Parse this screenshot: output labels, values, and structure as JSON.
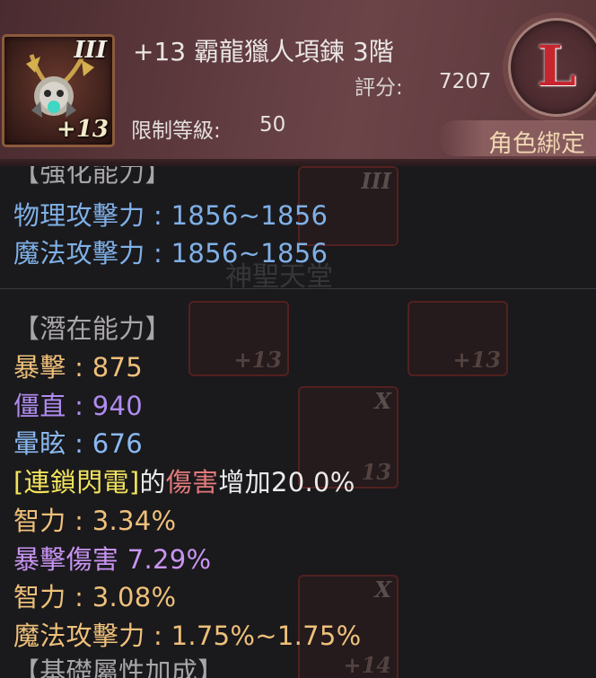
{
  "item": {
    "grade_numeral": "III",
    "enhance_badge": "+13",
    "title": "+13 霸龍獵人項鍊 3階",
    "score_label": "評分:",
    "score_value": "7207",
    "level_label": "限制等級:",
    "level_value": "50",
    "rank_letter": "L",
    "bind_status": "角色綁定"
  },
  "enhance_section": {
    "header": "【強化能力】",
    "stats": [
      {
        "label": "物理攻擊力 : 1856~1856"
      },
      {
        "label": "魔法攻擊力 : 1856~1856"
      }
    ]
  },
  "watermark": "神聖天堂",
  "potential_section": {
    "header": "【潛在能力】",
    "stats": [
      {
        "text": "暴擊 : 875"
      },
      {
        "text": "僵直 : 940"
      },
      {
        "text": "暈眩 : 676"
      },
      {
        "skill": "[連鎖閃電]",
        "of": "的",
        "damage": "傷害",
        "rest": "增加20.0%"
      },
      {
        "text": "智力 : 3.34%"
      },
      {
        "text": "暴擊傷害 7.29%"
      },
      {
        "text": "智力 : 3.08%"
      },
      {
        "text": "魔法攻擊力 : 1.75%~1.75%"
      }
    ]
  },
  "base_section": {
    "header": "【基礎屬性加成】"
  },
  "ghost_slots": [
    {
      "grade": "III",
      "badge": ""
    },
    {
      "grade": "",
      "badge": "+13"
    },
    {
      "grade": "",
      "badge": "+13"
    },
    {
      "grade": "X",
      "badge": "13"
    },
    {
      "grade": "X",
      "badge": "+14"
    }
  ],
  "colors": {
    "enhance_stat": "#7fb0e6",
    "crit": "#eec07a",
    "stiff": "#b08cef",
    "stun": "#8ab9f0",
    "skill": "#f2e35c",
    "damage": "#e27a7a",
    "crit_damage": "#c994f2",
    "rank_letter": "#c7262e",
    "bind_text": "#efd6b2"
  }
}
